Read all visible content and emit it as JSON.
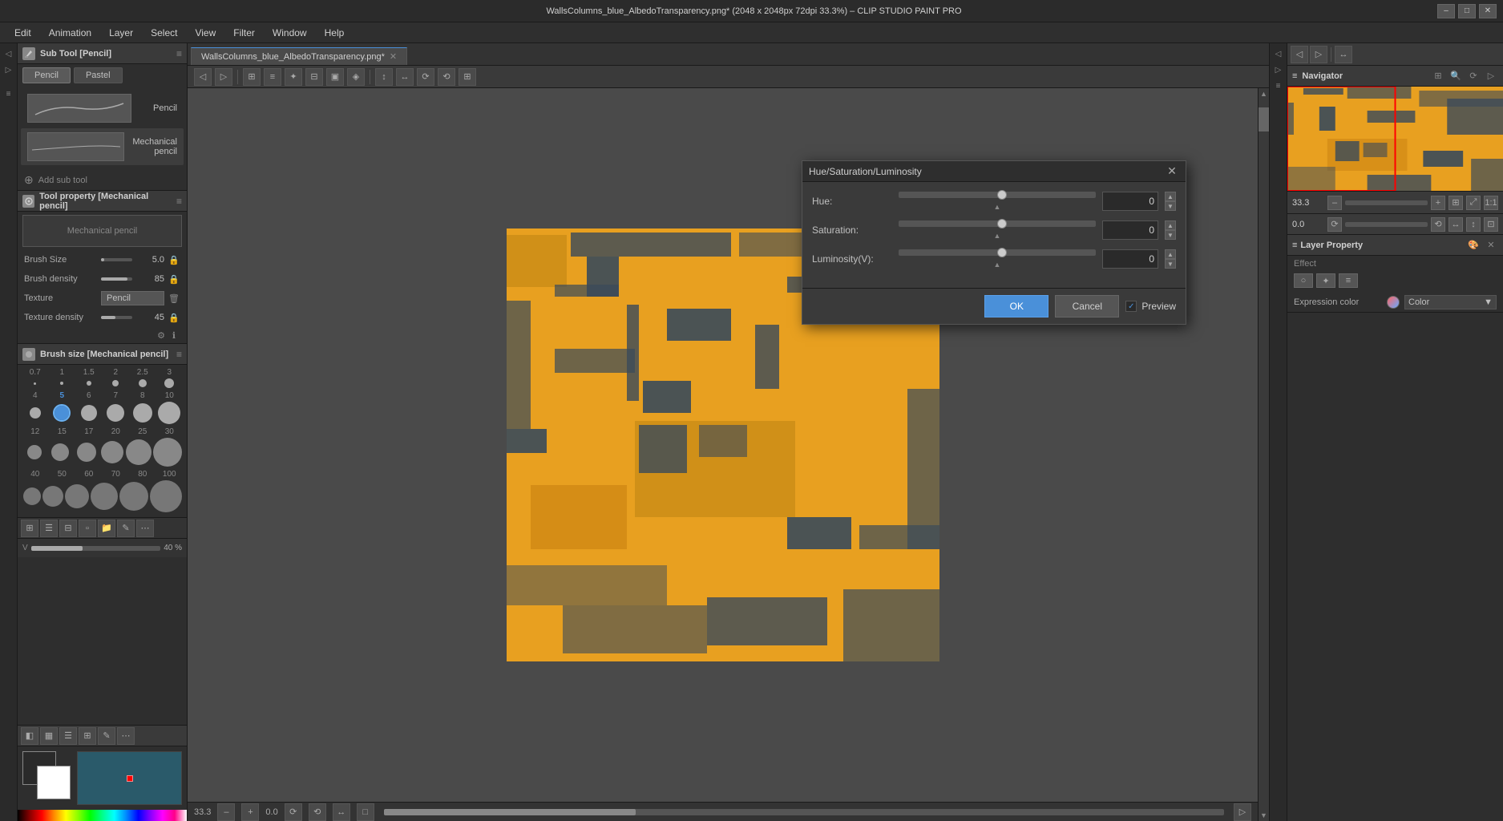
{
  "titlebar": {
    "title": "WallsColumns_blue_AlbedoTransparency.png* (2048 x 2048px 72dpi 33.3%) – CLIP STUDIO PAINT PRO",
    "minimize": "–",
    "maximize": "□",
    "close": "✕"
  },
  "menu": {
    "items": [
      "Edit",
      "Animation",
      "Layer",
      "Select",
      "View",
      "Filter",
      "Window",
      "Help"
    ]
  },
  "sub_tool_panel": {
    "title": "Sub Tool [Pencil]",
    "tabs": [
      "Pencil",
      "Pastel"
    ],
    "active_tab": "Pencil",
    "tools": [
      {
        "name": "Pencil",
        "preview": "pencil"
      },
      {
        "name": "Mechanical pencil",
        "preview": "mech-pencil"
      }
    ],
    "add_label": "Add sub tool"
  },
  "tool_property_panel": {
    "title": "Tool property [Mechanical pencil]",
    "tool_name": "Mechanical pencil",
    "properties": [
      {
        "label": "Brush Size",
        "value": "5.0",
        "percent": 10
      },
      {
        "label": "Brush density",
        "value": "85",
        "percent": 85
      },
      {
        "label": "Texture",
        "value": "Pencil",
        "percent": null
      },
      {
        "label": "Texture density",
        "value": "45",
        "percent": 45
      }
    ]
  },
  "brush_size_panel": {
    "title": "Brush size [Mechanical pencil]",
    "sizes_row1": [
      "0.7",
      "1",
      "1.5",
      "2",
      "2.5",
      "3"
    ],
    "sizes_row2": [
      "4",
      "5",
      "6",
      "7",
      "8",
      "10"
    ],
    "sizes_row3": [
      "12",
      "15",
      "17",
      "20",
      "25",
      "30"
    ],
    "sizes_row4": [
      "40",
      "50",
      "60",
      "70",
      "80",
      "100"
    ],
    "selected": "5"
  },
  "canvas": {
    "tab_name": "WallsColumns_blue_AlbedoTransparency.png*",
    "zoom": "33.3",
    "rotation": "0.0",
    "scroll_x": "0.0"
  },
  "navigator": {
    "title": "Navigator",
    "zoom": "33.3",
    "rotation": "0.0"
  },
  "layer_property": {
    "title": "Layer Property",
    "effect_label": "Effect",
    "expression_color_label": "Expression color",
    "color_option": "Color",
    "icons": [
      "🎨",
      "✦",
      "⟳",
      "▼"
    ]
  },
  "hsl_dialog": {
    "title": "Hue/Saturation/Luminosity",
    "hue_label": "Hue:",
    "hue_value": "0",
    "saturation_label": "Saturation:",
    "saturation_value": "0",
    "luminosity_label": "Luminosity(V):",
    "luminosity_value": "0",
    "ok_label": "OK",
    "cancel_label": "Cancel",
    "preview_label": "Preview",
    "preview_checked": true,
    "close": "✕"
  },
  "color_area": {
    "v_value": "40",
    "v_percent": 40
  }
}
